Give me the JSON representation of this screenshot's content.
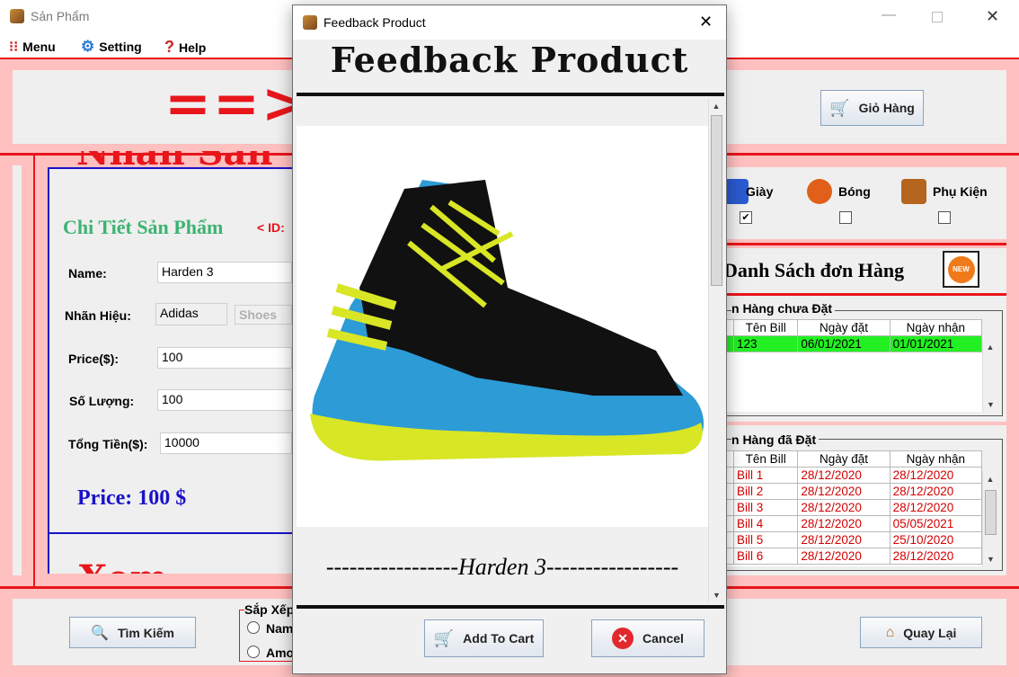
{
  "window": {
    "title": "Sản Phẩm"
  },
  "menubar": {
    "menu": "Menu",
    "setting": "Setting",
    "help": "Help"
  },
  "header": {
    "banner_text": "==>P",
    "cart_button": "Giỏ Hàng"
  },
  "detail": {
    "top_partial_text": "Nhãn Sản",
    "title": "Chi Tiết Sản Phẩm",
    "id_label": "< ID:",
    "name_label": "Name:",
    "name_value": "Harden 3",
    "brand_label": "Nhãn Hiệu:",
    "brand_value": "Adidas",
    "type_value": "Shoes",
    "price_label": "Price($):",
    "price_value": "100",
    "qty_label": "Số Lượng:",
    "qty_value": "100",
    "total_label": "Tổng Tiền($):",
    "total_value": "10000",
    "price_big": "Price: 100 $",
    "bottom_partial_text": "Xem thêm"
  },
  "categories": [
    {
      "label": "Giày",
      "icon": "shoe-icon",
      "checked": true
    },
    {
      "label": "Bóng",
      "icon": "ball-icon",
      "checked": false
    },
    {
      "label": "Phụ Kiện",
      "icon": "accessory-icon",
      "checked": false
    }
  ],
  "orders": {
    "title": "Danh Sách đơn Hàng",
    "new_badge": "NEW",
    "pending": {
      "legend": "n Hàng chưa Đặt",
      "columns": [
        "Tên Bill",
        "Ngày đặt",
        "Ngày nhận"
      ],
      "rows": [
        [
          "123",
          "06/01/2021",
          "01/01/2021"
        ]
      ]
    },
    "placed": {
      "legend": "n Hàng đã Đặt",
      "columns": [
        "Tên Bill",
        "Ngày đặt",
        "Ngày nhận"
      ],
      "rows": [
        [
          "Bill 1",
          "28/12/2020",
          "28/12/2020"
        ],
        [
          "Bill 2",
          "28/12/2020",
          "28/12/2020"
        ],
        [
          "Bill 3",
          "28/12/2020",
          "28/12/2020"
        ],
        [
          "Bill 4",
          "28/12/2020",
          "05/05/2021"
        ],
        [
          "Bill 5",
          "28/12/2020",
          "25/10/2020"
        ],
        [
          "Bill 6",
          "28/12/2020",
          "28/12/2020"
        ]
      ]
    }
  },
  "footer": {
    "search_button": "Tìm Kiếm",
    "sort_legend": "Sắp Xếp",
    "sort_name": "Name",
    "sort_amount": "Amount",
    "back_button": "Quay Lại"
  },
  "dialog": {
    "title": "Feedback Product",
    "heading": "Feedback Product",
    "product_caption": "-----------------Harden 3-----------------",
    "add_to_cart": "Add To Cart",
    "cancel": "Cancel"
  },
  "colors": {
    "accent_red": "#e8161b",
    "green_title": "#3cb371",
    "price_blue": "#1a12c8",
    "selected_row": "#22f022",
    "bill_red": "#d40000"
  }
}
